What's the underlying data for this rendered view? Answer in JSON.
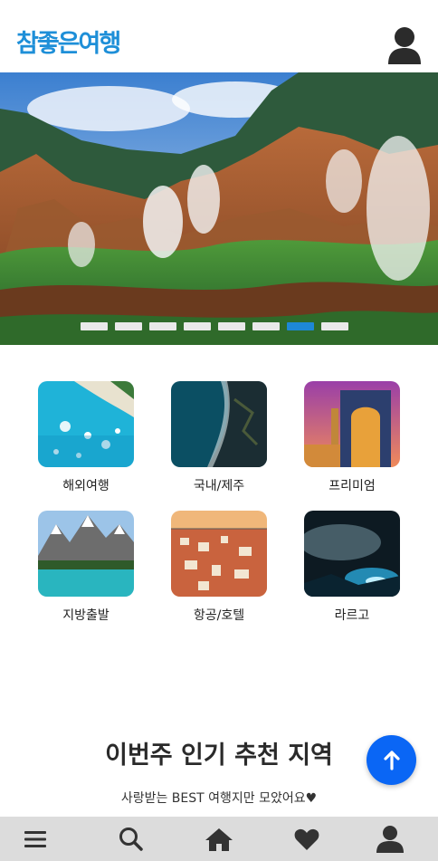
{
  "header": {
    "logo_text": "참좋은여행",
    "user_icon": "user-icon"
  },
  "hero": {
    "slide_count": 8,
    "active_slide": 7,
    "image_description_icon": "landscape-image"
  },
  "categories": [
    {
      "label": "해외여행"
    },
    {
      "label": "국내/제주"
    },
    {
      "label": "프리미엄"
    },
    {
      "label": "지방출발"
    },
    {
      "label": "항공/호텔"
    },
    {
      "label": "라르고"
    }
  ],
  "section": {
    "title": "이번주 인기 추천 지역",
    "subtitle": "사랑받는 BEST 여행지만 모았어요♥"
  },
  "fab": {
    "icon": "arrow-up-icon"
  },
  "bottom_nav": {
    "items": [
      "menu-icon",
      "search-icon",
      "home-icon",
      "heart-icon",
      "user-icon"
    ]
  },
  "colors": {
    "brand": "#1e8fd8",
    "fab": "#0a66f5",
    "nav_bg": "#dcdcdc",
    "active_dot": "#1e88d6"
  }
}
